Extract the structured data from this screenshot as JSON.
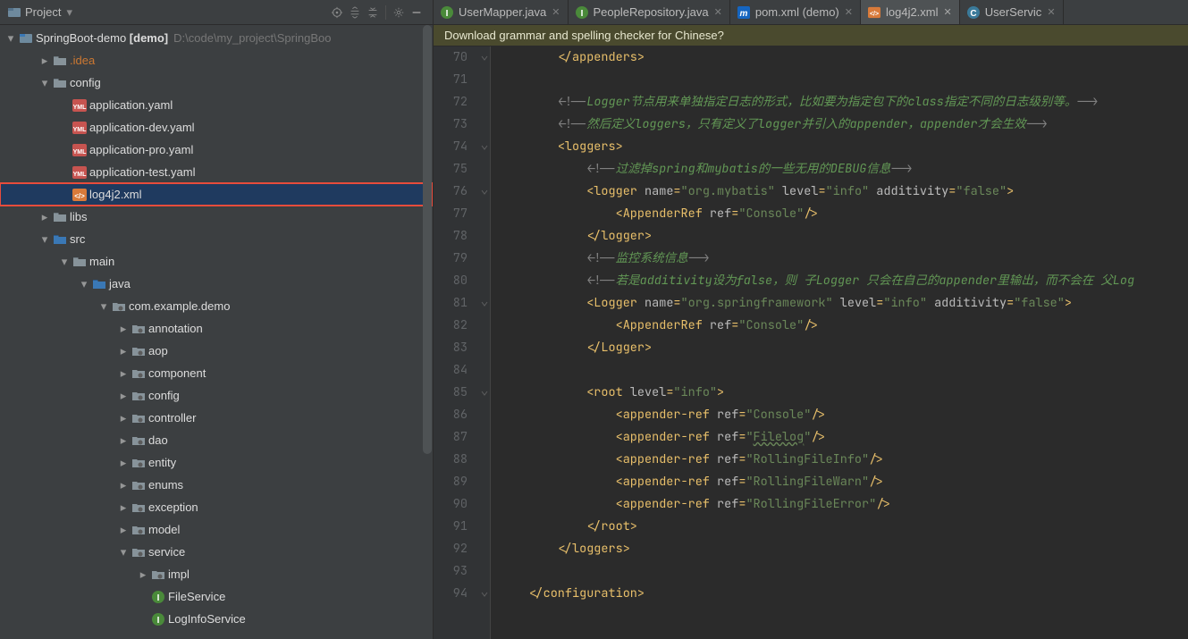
{
  "sidebar": {
    "title": "Project",
    "root": {
      "name": "SpringBoot-demo",
      "suffix": "[demo]",
      "path": "D:\\code\\my_project\\SpringBoo"
    },
    "items": [
      {
        "label": ".idea",
        "indent": 1,
        "arrow": "right",
        "icon": "folder",
        "cls": "lbl-orange"
      },
      {
        "label": "config",
        "indent": 1,
        "arrow": "down",
        "icon": "folder",
        "cls": "lbl-bright"
      },
      {
        "label": "application.yaml",
        "indent": 2,
        "arrow": "none",
        "icon": "yaml",
        "cls": "lbl-bright"
      },
      {
        "label": "application-dev.yaml",
        "indent": 2,
        "arrow": "none",
        "icon": "yaml",
        "cls": "lbl-bright"
      },
      {
        "label": "application-pro.yaml",
        "indent": 2,
        "arrow": "none",
        "icon": "yaml",
        "cls": "lbl-bright"
      },
      {
        "label": "application-test.yaml",
        "indent": 2,
        "arrow": "none",
        "icon": "yaml",
        "cls": "lbl-bright"
      },
      {
        "label": "log4j2.xml",
        "indent": 2,
        "arrow": "none",
        "icon": "xml",
        "cls": "lbl-bright",
        "selected": true,
        "highlighted": true
      },
      {
        "label": "libs",
        "indent": 1,
        "arrow": "right",
        "icon": "folder",
        "cls": "lbl-bright"
      },
      {
        "label": "src",
        "indent": 1,
        "arrow": "down",
        "icon": "folder-blue",
        "cls": "lbl-bright"
      },
      {
        "label": "main",
        "indent": 2,
        "arrow": "down",
        "icon": "folder",
        "cls": "lbl-bright"
      },
      {
        "label": "java",
        "indent": 3,
        "arrow": "down",
        "icon": "folder-blue",
        "cls": "lbl-bright"
      },
      {
        "label": "com.example.demo",
        "indent": 4,
        "arrow": "down",
        "icon": "package",
        "cls": "lbl-bright"
      },
      {
        "label": "annotation",
        "indent": 5,
        "arrow": "right",
        "icon": "package",
        "cls": "lbl-bright"
      },
      {
        "label": "aop",
        "indent": 5,
        "arrow": "right",
        "icon": "package",
        "cls": "lbl-bright"
      },
      {
        "label": "component",
        "indent": 5,
        "arrow": "right",
        "icon": "package",
        "cls": "lbl-bright"
      },
      {
        "label": "config",
        "indent": 5,
        "arrow": "right",
        "icon": "package",
        "cls": "lbl-bright"
      },
      {
        "label": "controller",
        "indent": 5,
        "arrow": "right",
        "icon": "package",
        "cls": "lbl-bright"
      },
      {
        "label": "dao",
        "indent": 5,
        "arrow": "right",
        "icon": "package",
        "cls": "lbl-bright"
      },
      {
        "label": "entity",
        "indent": 5,
        "arrow": "right",
        "icon": "package",
        "cls": "lbl-bright"
      },
      {
        "label": "enums",
        "indent": 5,
        "arrow": "right",
        "icon": "package",
        "cls": "lbl-bright"
      },
      {
        "label": "exception",
        "indent": 5,
        "arrow": "right",
        "icon": "package",
        "cls": "lbl-bright"
      },
      {
        "label": "model",
        "indent": 5,
        "arrow": "right",
        "icon": "package",
        "cls": "lbl-bright"
      },
      {
        "label": "service",
        "indent": 5,
        "arrow": "down",
        "icon": "package",
        "cls": "lbl-bright"
      },
      {
        "label": "impl",
        "indent": 6,
        "arrow": "right",
        "icon": "package",
        "cls": "lbl-bright"
      },
      {
        "label": "FileService",
        "indent": 6,
        "arrow": "none",
        "icon": "interface",
        "cls": "lbl-bright"
      },
      {
        "label": "LogInfoService",
        "indent": 6,
        "arrow": "none",
        "icon": "interface",
        "cls": "lbl-bright"
      }
    ]
  },
  "tabs": [
    {
      "label": "UserMapper.java",
      "icon": "interface",
      "active": false
    },
    {
      "label": "PeopleRepository.java",
      "icon": "interface",
      "active": false
    },
    {
      "label": "pom.xml (demo)",
      "icon": "maven",
      "active": false
    },
    {
      "label": "log4j2.xml",
      "icon": "xml",
      "active": true
    },
    {
      "label": "UserServic",
      "icon": "class",
      "active": false
    }
  ],
  "banner": "Download grammar and spelling checker for Chinese?",
  "editor": {
    "lineStart": 70,
    "lines": [
      {
        "html": "        <span class='c-tag'>&lt;/appenders&gt;</span>"
      },
      {
        "html": ""
      },
      {
        "html": "        <span class='c-cmt'>&lt;!--</span><span class='c-cmt-cn'>Logger节点用来单独指定日志的形式，比如要为指定包下的class指定不同的日志级别等。</span><span class='c-cmt'>--&gt;</span>"
      },
      {
        "html": "        <span class='c-cmt'>&lt;!--</span><span class='c-cmt-cn'>然后定义loggers，只有定义了logger并引入的appender，appender才会生效</span><span class='c-cmt'>--&gt;</span>"
      },
      {
        "html": "        <span class='c-tag'>&lt;loggers&gt;</span>"
      },
      {
        "html": "            <span class='c-cmt'>&lt;!--</span><span class='c-cmt-cn'>过滤掉spring和mybatis的一些无用的DEBUG信息</span><span class='c-cmt'>--&gt;</span>"
      },
      {
        "html": "            <span class='c-tag'>&lt;logger </span><span class='c-attr'>name</span><span class='c-tag'>=</span><span class='c-str'>\"org.mybatis\"</span> <span class='c-attr'>level</span><span class='c-tag'>=</span><span class='c-str'>\"info\"</span> <span class='c-attr'>additivity</span><span class='c-tag'>=</span><span class='c-str'>\"false\"</span><span class='c-tag'>&gt;</span>"
      },
      {
        "html": "                <span class='c-tag'>&lt;AppenderRef </span><span class='c-attr'>ref</span><span class='c-tag'>=</span><span class='c-str'>\"Console\"</span><span class='c-tag'>/&gt;</span>"
      },
      {
        "html": "            <span class='c-tag'>&lt;/logger&gt;</span>"
      },
      {
        "html": "            <span class='c-cmt'>&lt;!--</span><span class='c-cmt-cn'>监控系统信息</span><span class='c-cmt'>--&gt;</span>"
      },
      {
        "html": "            <span class='c-cmt'>&lt;!--</span><span class='c-cmt-cn'>若是additivity设为false，则 子Logger 只会在自己的appender里输出，而不会在 父Log</span>"
      },
      {
        "html": "            <span class='c-tag'>&lt;Logger </span><span class='c-attr'>name</span><span class='c-tag'>=</span><span class='c-str'>\"org.springframework\"</span> <span class='c-attr'>level</span><span class='c-tag'>=</span><span class='c-str'>\"info\"</span> <span class='c-attr'>additivity</span><span class='c-tag'>=</span><span class='c-str'>\"false\"</span><span class='c-tag'>&gt;</span>"
      },
      {
        "html": "                <span class='c-tag'>&lt;AppenderRef </span><span class='c-attr'>ref</span><span class='c-tag'>=</span><span class='c-str'>\"Console\"</span><span class='c-tag'>/&gt;</span>"
      },
      {
        "html": "            <span class='c-tag'>&lt;/Logger&gt;</span>"
      },
      {
        "html": ""
      },
      {
        "html": "            <span class='c-tag'>&lt;root </span><span class='c-attr'>level</span><span class='c-tag'>=</span><span class='c-str'>\"info\"</span><span class='c-tag'>&gt;</span>"
      },
      {
        "html": "                <span class='c-tag'>&lt;appender-ref </span><span class='c-attr'>ref</span><span class='c-tag'>=</span><span class='c-str'>\"Console\"</span><span class='c-tag'>/&gt;</span>"
      },
      {
        "html": "                <span class='c-tag'>&lt;appender-ref </span><span class='c-attr'>ref</span><span class='c-tag'>=</span><span class='c-str'>\"<span class='c-wavy'>Filelog</span>\"</span><span class='c-tag'>/&gt;</span>"
      },
      {
        "html": "                <span class='c-tag'>&lt;appender-ref </span><span class='c-attr'>ref</span><span class='c-tag'>=</span><span class='c-str'>\"RollingFileInfo\"</span><span class='c-tag'>/&gt;</span>"
      },
      {
        "html": "                <span class='c-tag'>&lt;appender-ref </span><span class='c-attr'>ref</span><span class='c-tag'>=</span><span class='c-str'>\"RollingFileWarn\"</span><span class='c-tag'>/&gt;</span>"
      },
      {
        "html": "                <span class='c-tag'>&lt;appender-ref </span><span class='c-attr'>ref</span><span class='c-tag'>=</span><span class='c-str'>\"RollingFileError\"</span><span class='c-tag'>/&gt;</span>"
      },
      {
        "html": "            <span class='c-tag'>&lt;/root&gt;</span>"
      },
      {
        "html": "        <span class='c-tag'>&lt;/loggers&gt;</span>"
      },
      {
        "html": ""
      },
      {
        "html": "    <span class='c-tag'>&lt;/configuration&gt;</span>"
      }
    ],
    "folds": [
      70,
      74,
      76,
      81,
      85,
      94
    ]
  }
}
